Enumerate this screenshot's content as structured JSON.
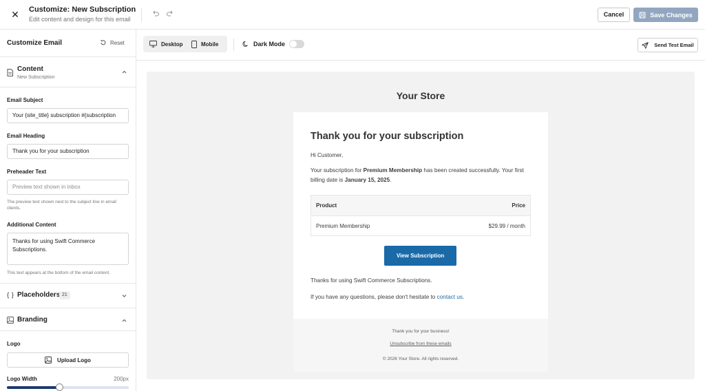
{
  "header": {
    "title": "Customize: New Subscription",
    "subtitle": "Edit content and design for this email",
    "cancel_label": "Cancel",
    "save_label": "Save Changes"
  },
  "sidebar": {
    "heading": "Customize Email",
    "reset_label": "Reset",
    "content_section": {
      "name": "Content",
      "subtitle": "New Subscription"
    },
    "fields": {
      "email_subject": {
        "label": "Email Subject",
        "value": "Your {site_title} subscription #{subscription"
      },
      "email_heading": {
        "label": "Email Heading",
        "value": "Thank you for your subscription"
      },
      "preheader": {
        "label": "Preheader Text",
        "placeholder": "Preview text shown in inbox",
        "help": "The preview text shown next to the subject line in email clients."
      },
      "additional_content": {
        "label": "Additional Content",
        "value": "Thanks for using Swift Commerce Subscriptions.",
        "help": "This text appears at the bottom of the email content."
      }
    },
    "placeholders": {
      "name": "Placeholders",
      "count": "21"
    },
    "branding": {
      "name": "Branding",
      "logo_label": "Logo",
      "upload_label": "Upload Logo",
      "logo_width_label": "Logo Width",
      "logo_width_value": "200px",
      "logo_width_fraction": 0.43
    }
  },
  "toolbar": {
    "desktop_label": "Desktop",
    "mobile_label": "Mobile",
    "dark_mode_label": "Dark Mode",
    "dark_mode_on": false,
    "send_test_label": "Send Test Email"
  },
  "preview": {
    "store_name": "Your Store",
    "heading": "Thank you for your subscription",
    "greeting": "Hi Customer,",
    "body_prefix": "Your subscription for ",
    "product_bold": "Premium Membership",
    "body_middle": " has been created successfully. Your first billing date is ",
    "date_bold": "January 15, 2025",
    "body_suffix": ".",
    "table": {
      "col_product": "Product",
      "col_price": "Price",
      "product": "Premium Membership",
      "price": "$29.99 / month"
    },
    "cta_label": "View Subscription",
    "thanks": "Thanks for using Swift Commerce Subscriptions.",
    "questions_prefix": "If you have any questions, please don't hesitate to ",
    "contact_link": "contact us",
    "questions_suffix": ".",
    "footer_thanks": "Thank you for your business!",
    "footer_unsubscribe": "Unsubscribe from these emails",
    "footer_copyright": "© 2026 Your Store. All rights reserved."
  },
  "colors": {
    "accent": "#1a6aa8",
    "save_button": "#93a6c0",
    "slider_fill": "#1e3a6e"
  }
}
